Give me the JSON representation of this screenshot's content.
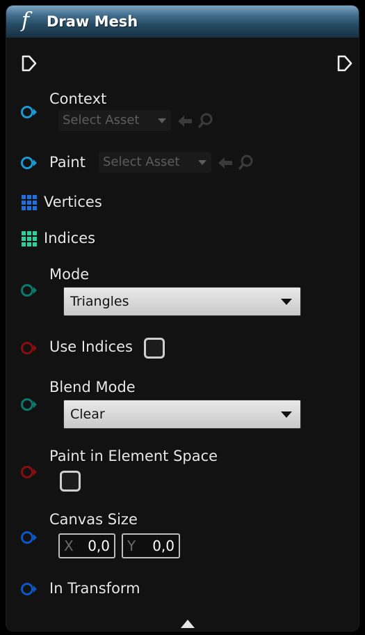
{
  "node": {
    "title": "Draw Mesh",
    "function_icon": "function-icon"
  },
  "pins": {
    "context": {
      "label": "Context",
      "asset_placeholder": "Select Asset",
      "color": "#1a9bd6"
    },
    "paint": {
      "label": "Paint",
      "asset_placeholder": "Select Asset",
      "color": "#1a9bd6"
    },
    "vertices": {
      "label": "Vertices",
      "color": "#1f6fe0"
    },
    "indices": {
      "label": "Indices",
      "color": "#2bd19b"
    },
    "mode": {
      "label": "Mode",
      "value": "Triangles",
      "color": "#0b7a6c"
    },
    "use_indices": {
      "label": "Use Indices",
      "checked": false,
      "color": "#8a0d0d"
    },
    "blend_mode": {
      "label": "Blend Mode",
      "value": "Clear",
      "color": "#0b7a6c"
    },
    "paint_in_element_space": {
      "label": "Paint in Element Space",
      "checked": false,
      "color": "#8a0d0d"
    },
    "canvas_size": {
      "label": "Canvas Size",
      "x_axis": "X",
      "x_value": "0,0",
      "y_axis": "Y",
      "y_value": "0,0",
      "color": "#0a57c8"
    },
    "in_transform": {
      "label": "In Transform",
      "color": "#0a57c8"
    }
  },
  "footer": {
    "expand_icon": "triangle-up-icon"
  }
}
